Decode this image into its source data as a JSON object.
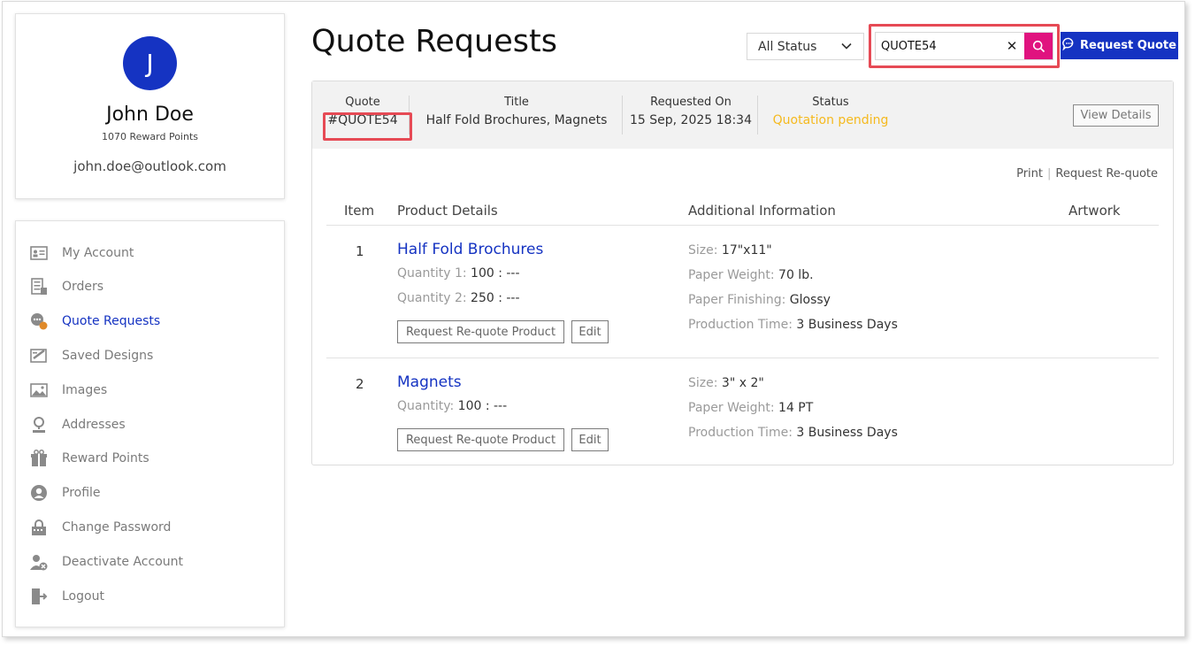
{
  "user": {
    "avatar_initial": "J",
    "name": "John Doe",
    "reward_points": "1070 Reward Points",
    "email": "john.doe@outlook.com"
  },
  "sidebar": {
    "items": [
      {
        "label": "My Account",
        "icon": "id-card-icon"
      },
      {
        "label": "Orders",
        "icon": "orders-icon"
      },
      {
        "label": "Quote Requests",
        "icon": "quote-chat-icon",
        "active": true
      },
      {
        "label": "Saved Designs",
        "icon": "design-icon"
      },
      {
        "label": "Images",
        "icon": "images-icon"
      },
      {
        "label": "Addresses",
        "icon": "location-icon"
      },
      {
        "label": "Reward Points",
        "icon": "gift-icon"
      },
      {
        "label": "Profile",
        "icon": "profile-icon"
      },
      {
        "label": "Change Password",
        "icon": "lock-icon"
      },
      {
        "label": "Deactivate Account",
        "icon": "user-remove-icon"
      },
      {
        "label": "Logout",
        "icon": "logout-icon"
      }
    ]
  },
  "header": {
    "title": "Quote Requests",
    "status_filter": "All Status",
    "search_value": "QUOTE54",
    "search_placeholder": "",
    "request_quote_label": "Request Quote"
  },
  "quote": {
    "labels": {
      "quote": "Quote",
      "title": "Title",
      "requested_on": "Requested On",
      "status": "Status"
    },
    "id": "#QUOTE54",
    "title": "Half Fold Brochures, Magnets",
    "requested_on": "15 Sep, 2025 18:34",
    "status": "Quotation pending",
    "view_details_label": "View Details",
    "print_label": "Print",
    "separator": "|",
    "request_requote_label": "Request Re-quote"
  },
  "table": {
    "headers": {
      "item": "Item",
      "product_details": "Product Details",
      "additional_information": "Additional Information",
      "artwork": "Artwork"
    },
    "rows": [
      {
        "num": "1",
        "name": "Half Fold Brochures",
        "quantities": [
          {
            "k": "Quantity 1:",
            "v": "100 : ---"
          },
          {
            "k": "Quantity 2:",
            "v": "250 : ---"
          }
        ],
        "specs": [
          {
            "k": "Size:",
            "v": "17\"x11\""
          },
          {
            "k": "Paper Weight:",
            "v": "70 lb."
          },
          {
            "k": "Paper Finishing:",
            "v": "Glossy"
          },
          {
            "k": "Production Time:",
            "v": "3 Business Days"
          }
        ],
        "requote_label": "Request Re-quote Product",
        "edit_label": "Edit"
      },
      {
        "num": "2",
        "name": "Magnets",
        "quantities": [
          {
            "k": "Quantity:",
            "v": "100 : ---"
          }
        ],
        "specs": [
          {
            "k": "Size:",
            "v": "3\" x 2\""
          },
          {
            "k": "Paper Weight:",
            "v": "14 PT"
          },
          {
            "k": "Production Time:",
            "v": "3 Business Days"
          }
        ],
        "requote_label": "Request Re-quote Product",
        "edit_label": "Edit"
      }
    ]
  },
  "colors": {
    "brand_blue": "#1533c2",
    "search_pink": "#e0137f",
    "status_pending": "#f5b91e",
    "highlight_red": "#e64a55"
  }
}
